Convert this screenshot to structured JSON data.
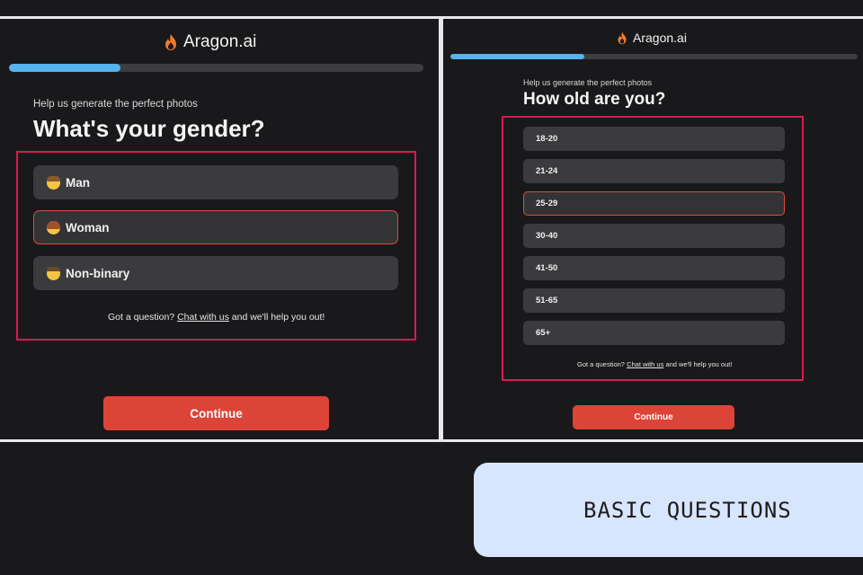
{
  "left": {
    "logo": "Aragon.ai",
    "progress": 0.27,
    "subtitle": "Help us generate the perfect photos",
    "heading": "What's your gender?",
    "options": [
      {
        "label": "Man",
        "icon": "man-emoji-icon"
      },
      {
        "label": "Woman",
        "icon": "woman-emoji-icon",
        "selected": true
      },
      {
        "label": "Non-binary",
        "icon": "person-emoji-icon"
      }
    ],
    "help_prefix": "Got a question?",
    "help_link": "Chat with us",
    "help_suffix": "and we'll help you out!",
    "continue": "Continue"
  },
  "right": {
    "logo": "Aragon.ai",
    "progress": 0.33,
    "subtitle": "Help us generate the perfect photos",
    "heading": "How old are you?",
    "options": [
      "18-20",
      "21-24",
      "25-29",
      "30-40",
      "41-50",
      "51-65",
      "65+"
    ],
    "selected_index": 2,
    "help_prefix": "Got a question?",
    "help_link": "Chat with us",
    "help_suffix": "and we'll help you out!",
    "continue": "Continue"
  },
  "tag": "BASIC QUESTIONS",
  "colors": {
    "background": "#19191b",
    "accent": "#db4437",
    "progress": "#55b3ee",
    "highlight": "#d81b50",
    "tag_bg": "#d7e6fc"
  }
}
